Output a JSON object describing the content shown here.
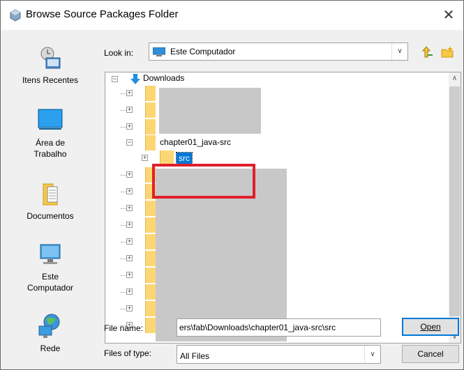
{
  "window": {
    "title": "Browse Source Packages Folder",
    "close_glyph": "✕"
  },
  "places": [
    {
      "label1": "Itens Recentes",
      "label2": "",
      "icon": "recent-items-icon"
    },
    {
      "label1": "Área de",
      "label2": "Trabalho",
      "icon": "desktop-icon"
    },
    {
      "label1": "Documentos",
      "label2": "",
      "icon": "documents-icon"
    },
    {
      "label1": "Este",
      "label2": "Computador",
      "icon": "computer-icon"
    },
    {
      "label1": "Rede",
      "label2": "",
      "icon": "network-icon"
    }
  ],
  "lookin": {
    "label": "Look in:",
    "value": "Este Computador",
    "arrow": "∨"
  },
  "tree": {
    "root": "Downloads",
    "selected_parent": "chapter01_java-src",
    "selected": "src",
    "collapsed_glyph": "+",
    "expanded_glyph": "−"
  },
  "scroll": {
    "up": "∧",
    "down": "∨"
  },
  "file_name": {
    "label": "File name:",
    "value": "ers\\fab\\Downloads\\chapter01_java-src\\src"
  },
  "files_of_type": {
    "label": "Files of type:",
    "value": "All Files",
    "arrow": "∨"
  },
  "buttons": {
    "open": "Open",
    "cancel": "Cancel"
  },
  "colors": {
    "highlight": "#e0202c",
    "selection": "#0078d7",
    "folder": "#fbd774"
  }
}
